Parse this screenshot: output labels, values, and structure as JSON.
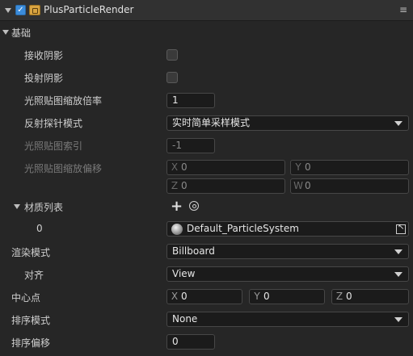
{
  "header": {
    "title": "PlusParticleRender",
    "menu_glyph": "≡"
  },
  "section": {
    "title": "基础"
  },
  "rows": {
    "receive_shadow": {
      "label": "接收阴影"
    },
    "cast_shadow": {
      "label": "投射阴影"
    },
    "lightmap_scale": {
      "label": "光照贴图缩放倍率",
      "value": "1"
    },
    "reflection_mode": {
      "label": "反射探针模式",
      "value": "实时简单采样模式"
    },
    "lightmap_index": {
      "label": "光照贴图索引",
      "value": "-1"
    },
    "lightmap_offset": {
      "label": "光照贴图缩放偏移",
      "x": "0",
      "y": "0",
      "z": "0",
      "w": "0"
    },
    "materials": {
      "label": "材质列表",
      "index": "0",
      "material_name": "Default_ParticleSystem"
    },
    "render_mode": {
      "label": "渲染模式",
      "value": "Billboard"
    },
    "alignment": {
      "label": "对齐",
      "value": "View"
    },
    "pivot": {
      "label": "中心点",
      "x": "0",
      "y": "0",
      "z": "0"
    },
    "sort_mode": {
      "label": "排序模式",
      "value": "None"
    },
    "sort_offset": {
      "label": "排序偏移",
      "value": "0"
    }
  },
  "axes": {
    "x": "X",
    "y": "Y",
    "z": "Z",
    "w": "W"
  },
  "colors": {
    "accent": "#3b8cdb",
    "panel_bg": "#262626",
    "header_bg": "#313131",
    "field_bg": "#1b1b1b"
  }
}
